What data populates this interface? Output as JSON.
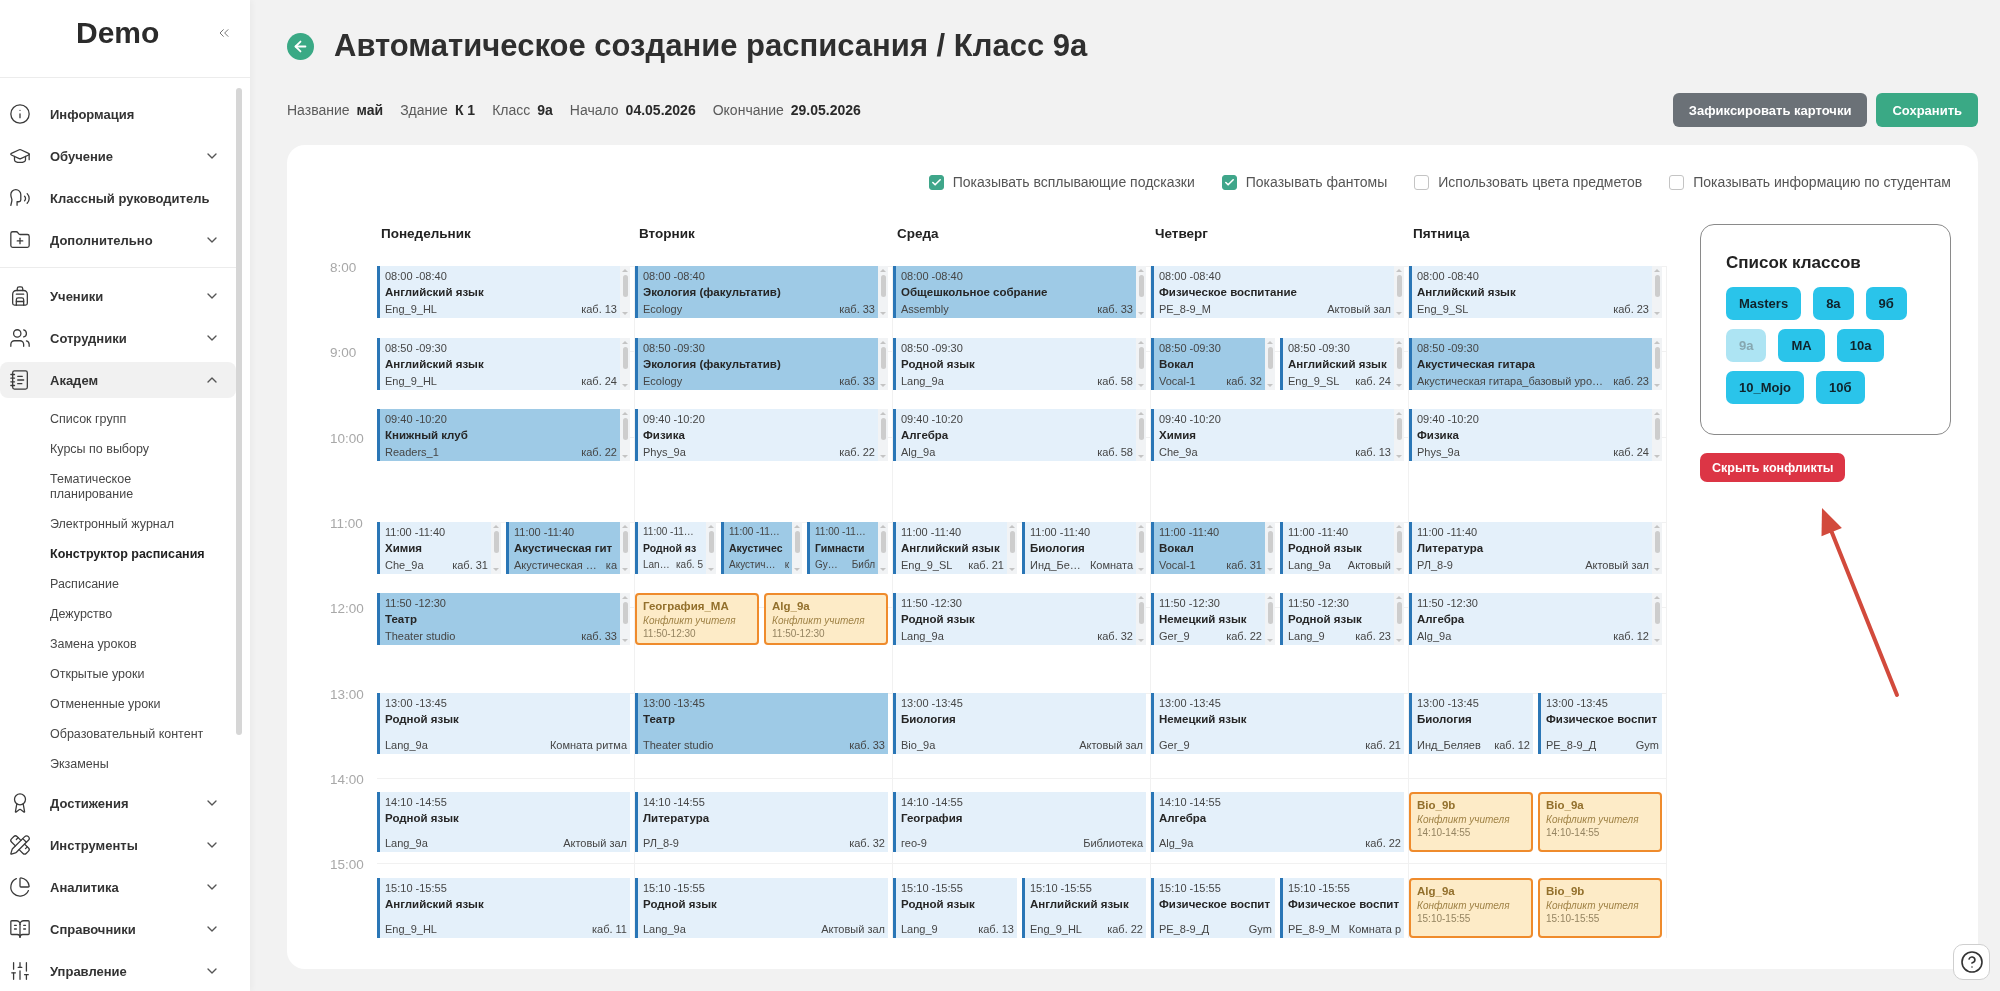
{
  "sidebar": {
    "logo": "Demo",
    "sections": [
      {
        "items": [
          {
            "label": "Информация"
          },
          {
            "label": "Обучение",
            "expanded": false
          },
          {
            "label": "Классный руководитель"
          },
          {
            "label": "Дополнительно",
            "expanded": false
          }
        ]
      },
      {
        "items": [
          {
            "label": "Ученики",
            "expanded": false
          },
          {
            "label": "Сотрудники",
            "expanded": false
          },
          {
            "label": "Академ",
            "expanded": true,
            "children": [
              {
                "label": "Список групп",
                "selected": false
              },
              {
                "label": "Курсы по выбору",
                "selected": false
              },
              {
                "label": "Тематическое планирование",
                "selected": false
              },
              {
                "label": "Электронный журнал",
                "selected": false
              },
              {
                "label": "Конструктор расписания",
                "selected": true
              },
              {
                "label": "Расписание",
                "selected": false
              },
              {
                "label": "Дежурство",
                "selected": false
              },
              {
                "label": "Замена уроков",
                "selected": false
              },
              {
                "label": "Открытые уроки",
                "selected": false
              },
              {
                "label": "Отмененные уроки",
                "selected": false
              },
              {
                "label": "Образовательный контент",
                "selected": false
              },
              {
                "label": "Экзамены",
                "selected": false
              }
            ]
          },
          {
            "label": "Достижения",
            "expanded": false
          },
          {
            "label": "Инструменты",
            "expanded": false
          },
          {
            "label": "Аналитика",
            "expanded": false
          },
          {
            "label": "Справочники",
            "expanded": false
          },
          {
            "label": "Управление",
            "expanded": false
          }
        ]
      }
    ]
  },
  "page": {
    "title": "Автоматическое создание расписания / Класс 9а",
    "details": [
      {
        "label": "Название",
        "value": "май"
      },
      {
        "label": "Здание",
        "value": "К 1"
      },
      {
        "label": "Класс",
        "value": "9а"
      },
      {
        "label": "Начало",
        "value": "04.05.2026"
      },
      {
        "label": "Окончание",
        "value": "29.05.2026"
      }
    ],
    "buttons": [
      {
        "label": "Зафиксировать карточки",
        "kind": "secondary"
      },
      {
        "label": "Сохранить",
        "kind": "primary"
      }
    ]
  },
  "options": [
    {
      "label": "Показывать всплывающие подсказки",
      "checked": true
    },
    {
      "label": "Показывать фантомы",
      "checked": true
    },
    {
      "label": "Использовать цвета предметов",
      "checked": false
    },
    {
      "label": "Показывать информацию по студентам",
      "checked": false
    }
  ],
  "timetable": {
    "hours": [
      "8:00",
      "9:00",
      "10:00",
      "11:00",
      "12:00",
      "13:00",
      "14:00",
      "15:00"
    ],
    "days": [
      {
        "name": "Понедельник",
        "slots": [
          [
            {
              "kind": "lesson",
              "time": "08:00 -08:40",
              "subject": "Английский язык",
              "group": "Eng_9_HL",
              "room": "каб. 13",
              "shaded": false,
              "scrollable": true
            }
          ],
          [
            {
              "kind": "lesson",
              "time": "08:50 -09:30",
              "subject": "Английский язык",
              "group": "Eng_9_HL",
              "room": "каб. 24",
              "shaded": false,
              "scrollable": true
            }
          ],
          [
            {
              "kind": "lesson",
              "time": "09:40 -10:20",
              "subject": "Книжный клуб",
              "group": "Readers_1",
              "room": "каб. 22",
              "shaded": true,
              "scrollable": true
            }
          ],
          [
            {
              "kind": "lesson",
              "time": "11:00 -11:40",
              "subject": "Химия",
              "group": "Che_9a",
              "room": "каб. 31",
              "shaded": false,
              "scrollable": true
            },
            {
              "kind": "lesson",
              "time": "11:00 -11:40",
              "subject": "Акустическая гит",
              "group": "Акустическая …",
              "room": "ка",
              "shaded": true,
              "scrollable": true
            }
          ],
          [
            {
              "kind": "lesson",
              "time": "11:50 -12:30",
              "subject": "Театр",
              "group": "Theater studio",
              "room": "каб. 33",
              "shaded": true,
              "scrollable": true
            }
          ],
          [
            {
              "kind": "lesson",
              "time": "13:00 -13:45",
              "subject": "Родной язык",
              "group": "Lang_9a",
              "room": "Комната ритма",
              "shaded": false,
              "scrollable": false
            }
          ],
          [
            {
              "kind": "lesson",
              "time": "14:10 -14:55",
              "subject": "Родной язык",
              "group": "Lang_9a",
              "room": "Актовый зал",
              "shaded": false,
              "scrollable": false
            }
          ],
          [
            {
              "kind": "lesson",
              "time": "15:10 -15:55",
              "subject": "Английский язык",
              "group": "Eng_9_HL",
              "room": "каб. 11",
              "shaded": false,
              "scrollable": false
            }
          ]
        ]
      },
      {
        "name": "Вторник",
        "slots": [
          [
            {
              "kind": "lesson",
              "time": "08:00 -08:40",
              "subject": "Экология (факультатив)",
              "group": "Ecology",
              "room": "каб. 33",
              "shaded": true,
              "scrollable": true
            }
          ],
          [
            {
              "kind": "lesson",
              "time": "08:50 -09:30",
              "subject": "Экология (факультатив)",
              "group": "Ecology",
              "room": "каб. 33",
              "shaded": true,
              "scrollable": true
            }
          ],
          [
            {
              "kind": "lesson",
              "time": "09:40 -10:20",
              "subject": "Физика",
              "group": "Phys_9a",
              "room": "каб. 22",
              "shaded": false,
              "scrollable": true
            }
          ],
          [
            {
              "kind": "lesson",
              "time": "11:00 -11…",
              "subject": "Родной яз",
              "group": "Lan…",
              "room": "каб. 5",
              "shaded": false,
              "scrollable": true
            },
            {
              "kind": "lesson",
              "time": "11:00 -11…",
              "subject": "Акустичес",
              "group": "Акустич…",
              "room": "к",
              "shaded": true,
              "scrollable": true
            },
            {
              "kind": "lesson",
              "time": "11:00 -11…",
              "subject": "Гимнасти",
              "group": "Gy…",
              "room": "Библ",
              "shaded": true,
              "scrollable": true
            }
          ],
          [
            {
              "kind": "conflict",
              "title": "География_МА",
              "note": "Конфликт учителя",
              "time": "11:50-12:30"
            },
            {
              "kind": "conflict",
              "title": "Alg_9a",
              "note": "Конфликт учителя",
              "time": "11:50-12:30"
            }
          ],
          [
            {
              "kind": "lesson",
              "time": "13:00 -13:45",
              "subject": "Театр",
              "group": "Theater studio",
              "room": "каб. 33",
              "shaded": true,
              "scrollable": false
            }
          ],
          [
            {
              "kind": "lesson",
              "time": "14:10 -14:55",
              "subject": "Литература",
              "group": "РЛ_8-9",
              "room": "каб. 32",
              "shaded": false,
              "scrollable": false
            }
          ],
          [
            {
              "kind": "lesson",
              "time": "15:10 -15:55",
              "subject": "Родной язык",
              "group": "Lang_9a",
              "room": "Актовый зал",
              "shaded": false,
              "scrollable": false
            }
          ]
        ]
      },
      {
        "name": "Среда",
        "slots": [
          [
            {
              "kind": "lesson",
              "time": "08:00 -08:40",
              "subject": "Общешкольное собрание",
              "group": "Assembly",
              "room": "каб. 33",
              "shaded": true,
              "scrollable": true
            }
          ],
          [
            {
              "kind": "lesson",
              "time": "08:50 -09:30",
              "subject": "Родной язык",
              "group": "Lang_9a",
              "room": "каб. 58",
              "shaded": false,
              "scrollable": true
            }
          ],
          [
            {
              "kind": "lesson",
              "time": "09:40 -10:20",
              "subject": "Алгебра",
              "group": "Alg_9a",
              "room": "каб. 58",
              "shaded": false,
              "scrollable": true
            }
          ],
          [
            {
              "kind": "lesson",
              "time": "11:00 -11:40",
              "subject": "Английский язык",
              "group": "Eng_9_SL",
              "room": "каб. 21",
              "shaded": false,
              "scrollable": true
            },
            {
              "kind": "lesson",
              "time": "11:00 -11:40",
              "subject": "Биология",
              "group": "Инд_Бе…",
              "room": "Комната",
              "shaded": false,
              "scrollable": true
            }
          ],
          [
            {
              "kind": "lesson",
              "time": "11:50 -12:30",
              "subject": "Родной язык",
              "group": "Lang_9a",
              "room": "каб. 32",
              "shaded": false,
              "scrollable": true
            }
          ],
          [
            {
              "kind": "lesson",
              "time": "13:00 -13:45",
              "subject": "Биология",
              "group": "Bio_9a",
              "room": "Актовый зал",
              "shaded": false,
              "scrollable": false
            }
          ],
          [
            {
              "kind": "lesson",
              "time": "14:10 -14:55",
              "subject": "География",
              "group": "гео-9",
              "room": "Библиотека",
              "shaded": false,
              "scrollable": false
            }
          ],
          [
            {
              "kind": "lesson",
              "time": "15:10 -15:55",
              "subject": "Родной язык",
              "group": "Lang_9",
              "room": "каб. 13",
              "shaded": false,
              "scrollable": false
            },
            {
              "kind": "lesson",
              "time": "15:10 -15:55",
              "subject": "Английский язык",
              "group": "Eng_9_HL",
              "room": "каб. 22",
              "shaded": false,
              "scrollable": false
            }
          ]
        ]
      },
      {
        "name": "Четверг",
        "slots": [
          [
            {
              "kind": "lesson",
              "time": "08:00 -08:40",
              "subject": "Физическое воспитание",
              "group": "PE_8-9_M",
              "room": "Актовый зал",
              "shaded": false,
              "scrollable": true
            }
          ],
          [
            {
              "kind": "lesson",
              "time": "08:50 -09:30",
              "subject": "Вокал",
              "group": "Vocal-1",
              "room": "каб. 32",
              "shaded": true,
              "scrollable": true
            },
            {
              "kind": "lesson",
              "time": "08:50 -09:30",
              "subject": "Английский язык",
              "group": "Eng_9_SL",
              "room": "каб. 24",
              "shaded": false,
              "scrollable": true
            }
          ],
          [
            {
              "kind": "lesson",
              "time": "09:40 -10:20",
              "subject": "Химия",
              "group": "Che_9a",
              "room": "каб. 13",
              "shaded": false,
              "scrollable": true
            }
          ],
          [
            {
              "kind": "lesson",
              "time": "11:00 -11:40",
              "subject": "Вокал",
              "group": "Vocal-1",
              "room": "каб. 31",
              "shaded": true,
              "scrollable": true
            },
            {
              "kind": "lesson",
              "time": "11:00 -11:40",
              "subject": "Родной язык",
              "group": "Lang_9a",
              "room": "Актовый",
              "shaded": false,
              "scrollable": true
            }
          ],
          [
            {
              "kind": "lesson",
              "time": "11:50 -12:30",
              "subject": "Немецкий язык",
              "group": "Ger_9",
              "room": "каб. 22",
              "shaded": false,
              "scrollable": true
            },
            {
              "kind": "lesson",
              "time": "11:50 -12:30",
              "subject": "Родной язык",
              "group": "Lang_9",
              "room": "каб. 23",
              "shaded": false,
              "scrollable": true
            }
          ],
          [
            {
              "kind": "lesson",
              "time": "13:00 -13:45",
              "subject": "Немецкий язык",
              "group": "Ger_9",
              "room": "каб. 21",
              "shaded": false,
              "scrollable": false
            }
          ],
          [
            {
              "kind": "lesson",
              "time": "14:10 -14:55",
              "subject": "Алгебра",
              "group": "Alg_9a",
              "room": "каб. 22",
              "shaded": false,
              "scrollable": false
            }
          ],
          [
            {
              "kind": "lesson",
              "time": "15:10 -15:55",
              "subject": "Физическое воспит",
              "group": "PE_8-9_Д",
              "room": "Gym",
              "shaded": false,
              "scrollable": false
            },
            {
              "kind": "lesson",
              "time": "15:10 -15:55",
              "subject": "Физическое воспит",
              "group": "PE_8-9_M",
              "room": "Комната р",
              "shaded": false,
              "scrollable": false
            }
          ]
        ]
      },
      {
        "name": "Пятница",
        "slots": [
          [
            {
              "kind": "lesson",
              "time": "08:00 -08:40",
              "subject": "Английский язык",
              "group": "Eng_9_SL",
              "room": "каб. 23",
              "shaded": false,
              "scrollable": true
            }
          ],
          [
            {
              "kind": "lesson",
              "time": "08:50 -09:30",
              "subject": "Акустическая гитара",
              "group": "Акустическая гитара_базовый уро…",
              "room": "каб. 23",
              "shaded": true,
              "scrollable": true
            }
          ],
          [
            {
              "kind": "lesson",
              "time": "09:40 -10:20",
              "subject": "Физика",
              "group": "Phys_9a",
              "room": "каб. 24",
              "shaded": false,
              "scrollable": true
            }
          ],
          [
            {
              "kind": "lesson",
              "time": "11:00 -11:40",
              "subject": "Литература",
              "group": "РЛ_8-9",
              "room": "Актовый зал",
              "shaded": false,
              "scrollable": true
            }
          ],
          [
            {
              "kind": "lesson",
              "time": "11:50 -12:30",
              "subject": "Алгебра",
              "group": "Alg_9a",
              "room": "каб. 12",
              "shaded": false,
              "scrollable": true
            }
          ],
          [
            {
              "kind": "lesson",
              "time": "13:00 -13:45",
              "subject": "Биология",
              "group": "Инд_Беляев",
              "room": "каб. 12",
              "shaded": false,
              "scrollable": false
            },
            {
              "kind": "lesson",
              "time": "13:00 -13:45",
              "subject": "Физическое воспит",
              "group": "PE_8-9_Д",
              "room": "Gym",
              "shaded": false,
              "scrollable": false
            }
          ],
          [
            {
              "kind": "conflict",
              "title": "Bio_9b",
              "note": "Конфликт учителя",
              "time": "14:10-14:55"
            },
            {
              "kind": "conflict",
              "title": "Bio_9a",
              "note": "Конфликт учителя",
              "time": "14:10-14:55"
            }
          ],
          [
            {
              "kind": "conflict",
              "title": "Alg_9a",
              "note": "Конфликт учителя",
              "time": "15:10-15:55"
            },
            {
              "kind": "conflict",
              "title": "Bio_9b",
              "note": "Конфликт учителя",
              "time": "15:10-15:55"
            }
          ]
        ]
      }
    ]
  },
  "class_list": {
    "title": "Список классов",
    "classes": [
      {
        "label": "Masters",
        "selected": false
      },
      {
        "label": "8а",
        "selected": false
      },
      {
        "label": "9б",
        "selected": false
      },
      {
        "label": "9а",
        "selected": true
      },
      {
        "label": "МА",
        "selected": false
      },
      {
        "label": "10а",
        "selected": false
      },
      {
        "label": "10_Mojo",
        "selected": false
      },
      {
        "label": "10б",
        "selected": false
      }
    ]
  },
  "conflicts_button": {
    "label": "Скрыть конфликты"
  }
}
